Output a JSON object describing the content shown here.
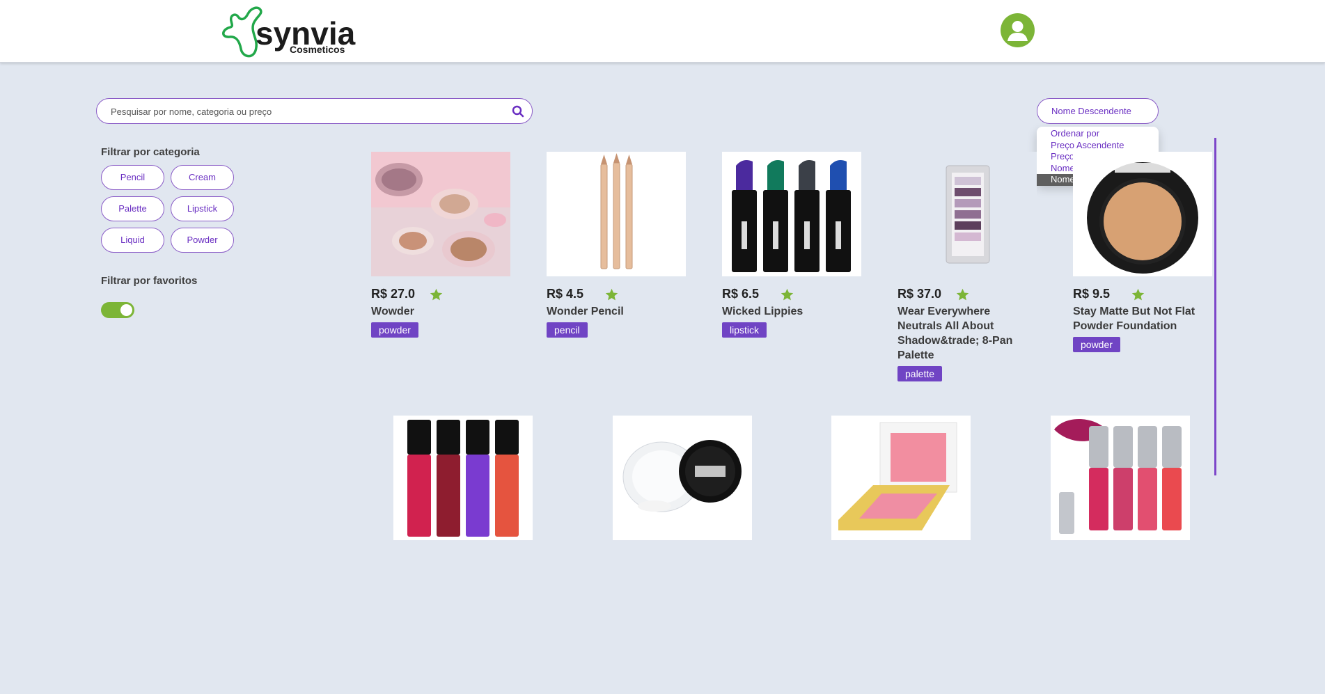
{
  "header": {
    "brand": "synvia",
    "subtitle": "Cosmeticos"
  },
  "search": {
    "placeholder": "Pesquisar por nome, categoria ou preço"
  },
  "sort": {
    "selected": "Nome Descendente",
    "options": [
      "Ordenar por",
      "Preço Ascendente",
      "Preço Descendente",
      "Nome Ascendente",
      "Nome Descendente"
    ]
  },
  "filters": {
    "category_title": "Filtrar por categoria",
    "categories": [
      "Pencil",
      "Cream",
      "Palette",
      "Lipstick",
      "Liquid",
      "Powder"
    ],
    "favorites_title": "Filtrar por favoritos",
    "favorites_on": true
  },
  "products": [
    {
      "price": "R$ 27.0",
      "name": "Wowder",
      "tag": "powder"
    },
    {
      "price": "R$ 4.5",
      "name": "Wonder Pencil",
      "tag": "pencil"
    },
    {
      "price": "R$ 6.5",
      "name": "Wicked Lippies",
      "tag": "lipstick"
    },
    {
      "price": "R$ 37.0",
      "name": "Wear Everywhere Neutrals All About Shadow&trade; 8-Pan Palette",
      "tag": "palette"
    },
    {
      "price": "R$ 9.5",
      "name": "Stay Matte But Not Flat Powder Foundation",
      "tag": "powder"
    }
  ],
  "colors": {
    "accent_purple": "#6a2fc2",
    "tag_purple": "#7044c4",
    "brand_green": "#7cb537",
    "background": "#e1e7f0"
  }
}
